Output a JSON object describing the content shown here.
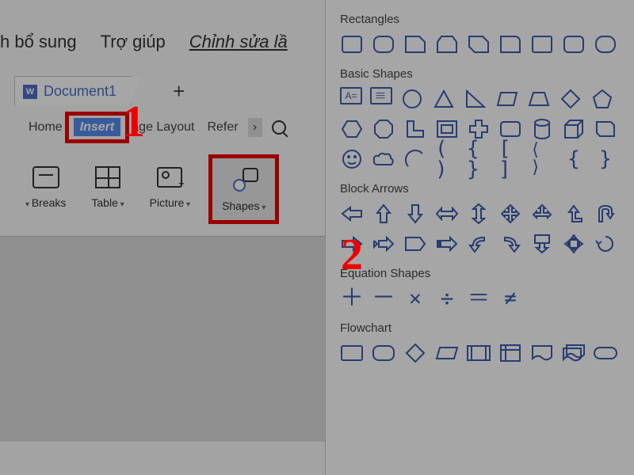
{
  "top_menu": {
    "item2": "h bổ sung",
    "item3": "Trợ giúp",
    "item4": "Chỉnh sửa lầ"
  },
  "tab": {
    "doc_label": "Document1"
  },
  "ribbon_tabs": {
    "home": "Home",
    "insert": "Insert",
    "page_layout": "age Layout",
    "references": "Refer"
  },
  "tools": {
    "breaks": "Breaks",
    "table": "Table",
    "picture": "Picture",
    "shapes": "Shapes"
  },
  "annotations": {
    "a1": "1",
    "a2": "2"
  },
  "panel": {
    "rectangles": "Rectangles",
    "basic_shapes": "Basic Shapes",
    "block_arrows": "Block Arrows",
    "equation_shapes": "Equation Shapes",
    "flowchart": "Flowchart",
    "az": "A="
  }
}
